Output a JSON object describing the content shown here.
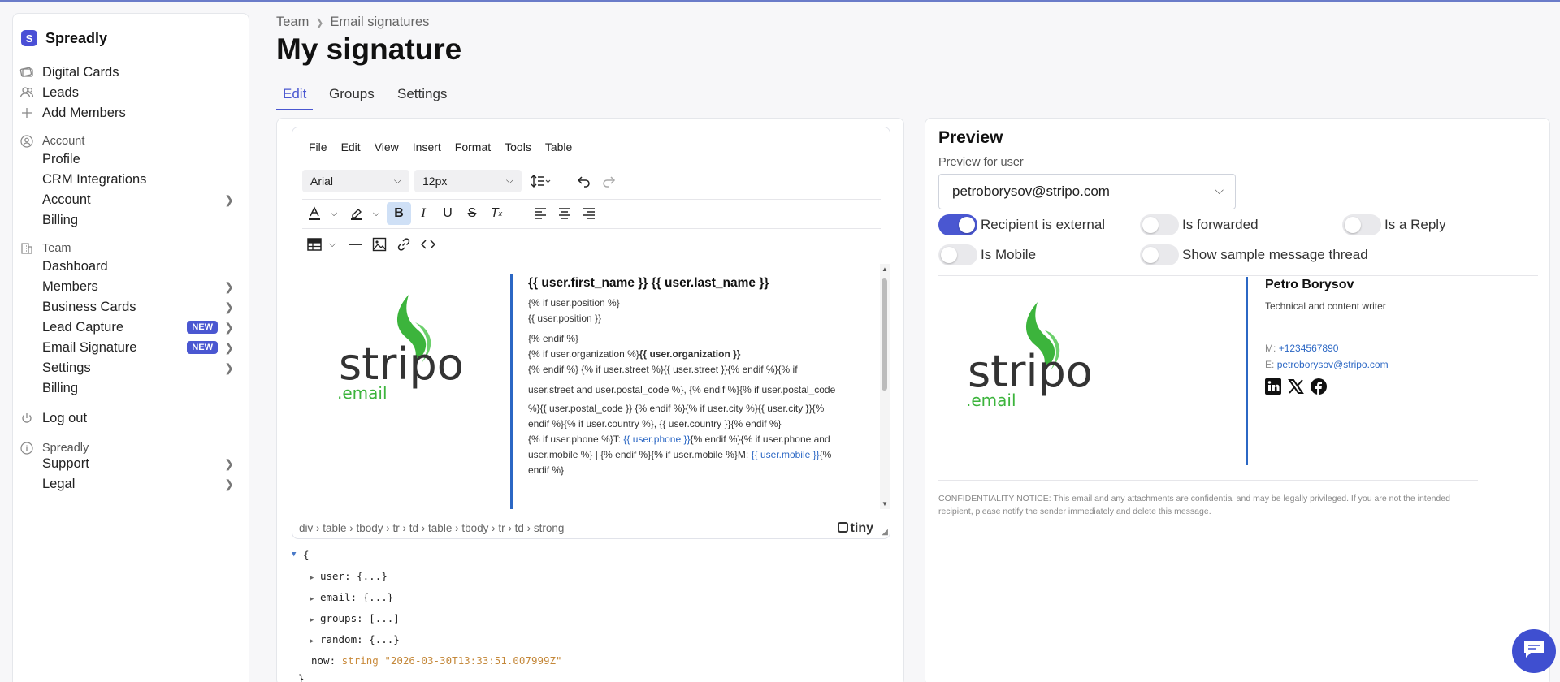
{
  "app": {
    "name": "Spreadly"
  },
  "sidebar": {
    "top_items": [
      {
        "label": "Digital Cards",
        "icon": "cards-icon"
      },
      {
        "label": "Leads",
        "icon": "users-icon"
      },
      {
        "label": "Add Members",
        "icon": "plus-icon"
      }
    ],
    "account_section": {
      "title": "Account",
      "items": [
        "Profile",
        "CRM Integrations",
        "Account",
        "Billing"
      ]
    },
    "team_section": {
      "title": "Team",
      "items": [
        "Dashboard",
        "Members",
        "Business Cards",
        "Lead Capture",
        "Email Signature",
        "Settings",
        "Billing"
      ],
      "badge": "NEW"
    },
    "logout": "Log out",
    "spreadly_section": {
      "title": "Spreadly",
      "items": [
        "Support",
        "Legal"
      ]
    }
  },
  "header": {
    "breadcrumb": [
      "Team",
      "Email signatures"
    ],
    "title": "My signature",
    "tabs": [
      "Edit",
      "Groups",
      "Settings"
    ],
    "active_tab": "Edit"
  },
  "editor": {
    "menu": [
      "File",
      "Edit",
      "View",
      "Insert",
      "Format",
      "Tools",
      "Table"
    ],
    "font_family": "Arial",
    "font_size": "12px",
    "content": {
      "name_line": "{{ user.first_name }} {{ user.last_name }}",
      "line1": "{% if user.position %}",
      "line2": "{{ user.position }}",
      "line3": "{% endif %}",
      "line4a": "{% if user.organization %}",
      "line4b": "{{ user.organization }}",
      "line5": "{% endif %} {% if user.street %}{{ user.street }}{% endif %}{% if",
      "line6": "user.street and user.postal_code %}, {% endif %}{% if user.postal_code",
      "line7": "%}{{ user.postal_code }} {% endif %}{% if user.city %}{{ user.city }}{%",
      "line8": "endif %}{% if user.country %}, {{ user.country }}{% endif %}",
      "line9a": "{% if user.phone %}T: ",
      "line9b": "{{ user.phone }}",
      "line9c": "{% endif %}{% if user.phone and",
      "line10a": "user.mobile %} | {% endif %}{% if user.mobile %}M: ",
      "line10b": "{{ user.mobile }}",
      "line10c": "{%",
      "line11": "endif %}"
    },
    "status_path": "div › table › tbody › tr › td › table › tbody › tr › td › strong",
    "brand": "tiny",
    "logo_text": "stripo",
    "logo_sub": ".email"
  },
  "json_view": {
    "open": "{",
    "rows": [
      {
        "key": "user",
        "value": "{...}"
      },
      {
        "key": "email",
        "value": "{...}"
      },
      {
        "key": "groups",
        "value": "[...]"
      },
      {
        "key": "random",
        "value": "{...}"
      }
    ],
    "now_key": "now",
    "now_type": "string",
    "now_value": "\"2026-03-30T13:33:51.007999Z\"",
    "close": "}"
  },
  "preview": {
    "title": "Preview",
    "label": "Preview for user",
    "selected_user": "petroborysov@stripo.com",
    "toggles": [
      {
        "label": "Recipient is external",
        "on": true
      },
      {
        "label": "Is forwarded",
        "on": false
      },
      {
        "label": "Is a Reply",
        "on": false
      },
      {
        "label": "Is Mobile",
        "on": false
      },
      {
        "label": "Show sample message thread",
        "on": false
      }
    ],
    "signature": {
      "name": "Petro Borysov",
      "position": "Technical and content writer",
      "mobile_label": "M:",
      "mobile": "+1234567890",
      "email_label": "E:",
      "email": "petroborysov@stripo.com"
    },
    "confidentiality": "CONFIDENTIALITY NOTICE: This email and any attachments are confidential and may be legally privileged. If you are not the intended recipient, please notify the sender immediately and delete this message."
  },
  "colors": {
    "accent": "#4a57d1",
    "link": "#2b67c4",
    "stripo_green": "#3cb43c"
  }
}
